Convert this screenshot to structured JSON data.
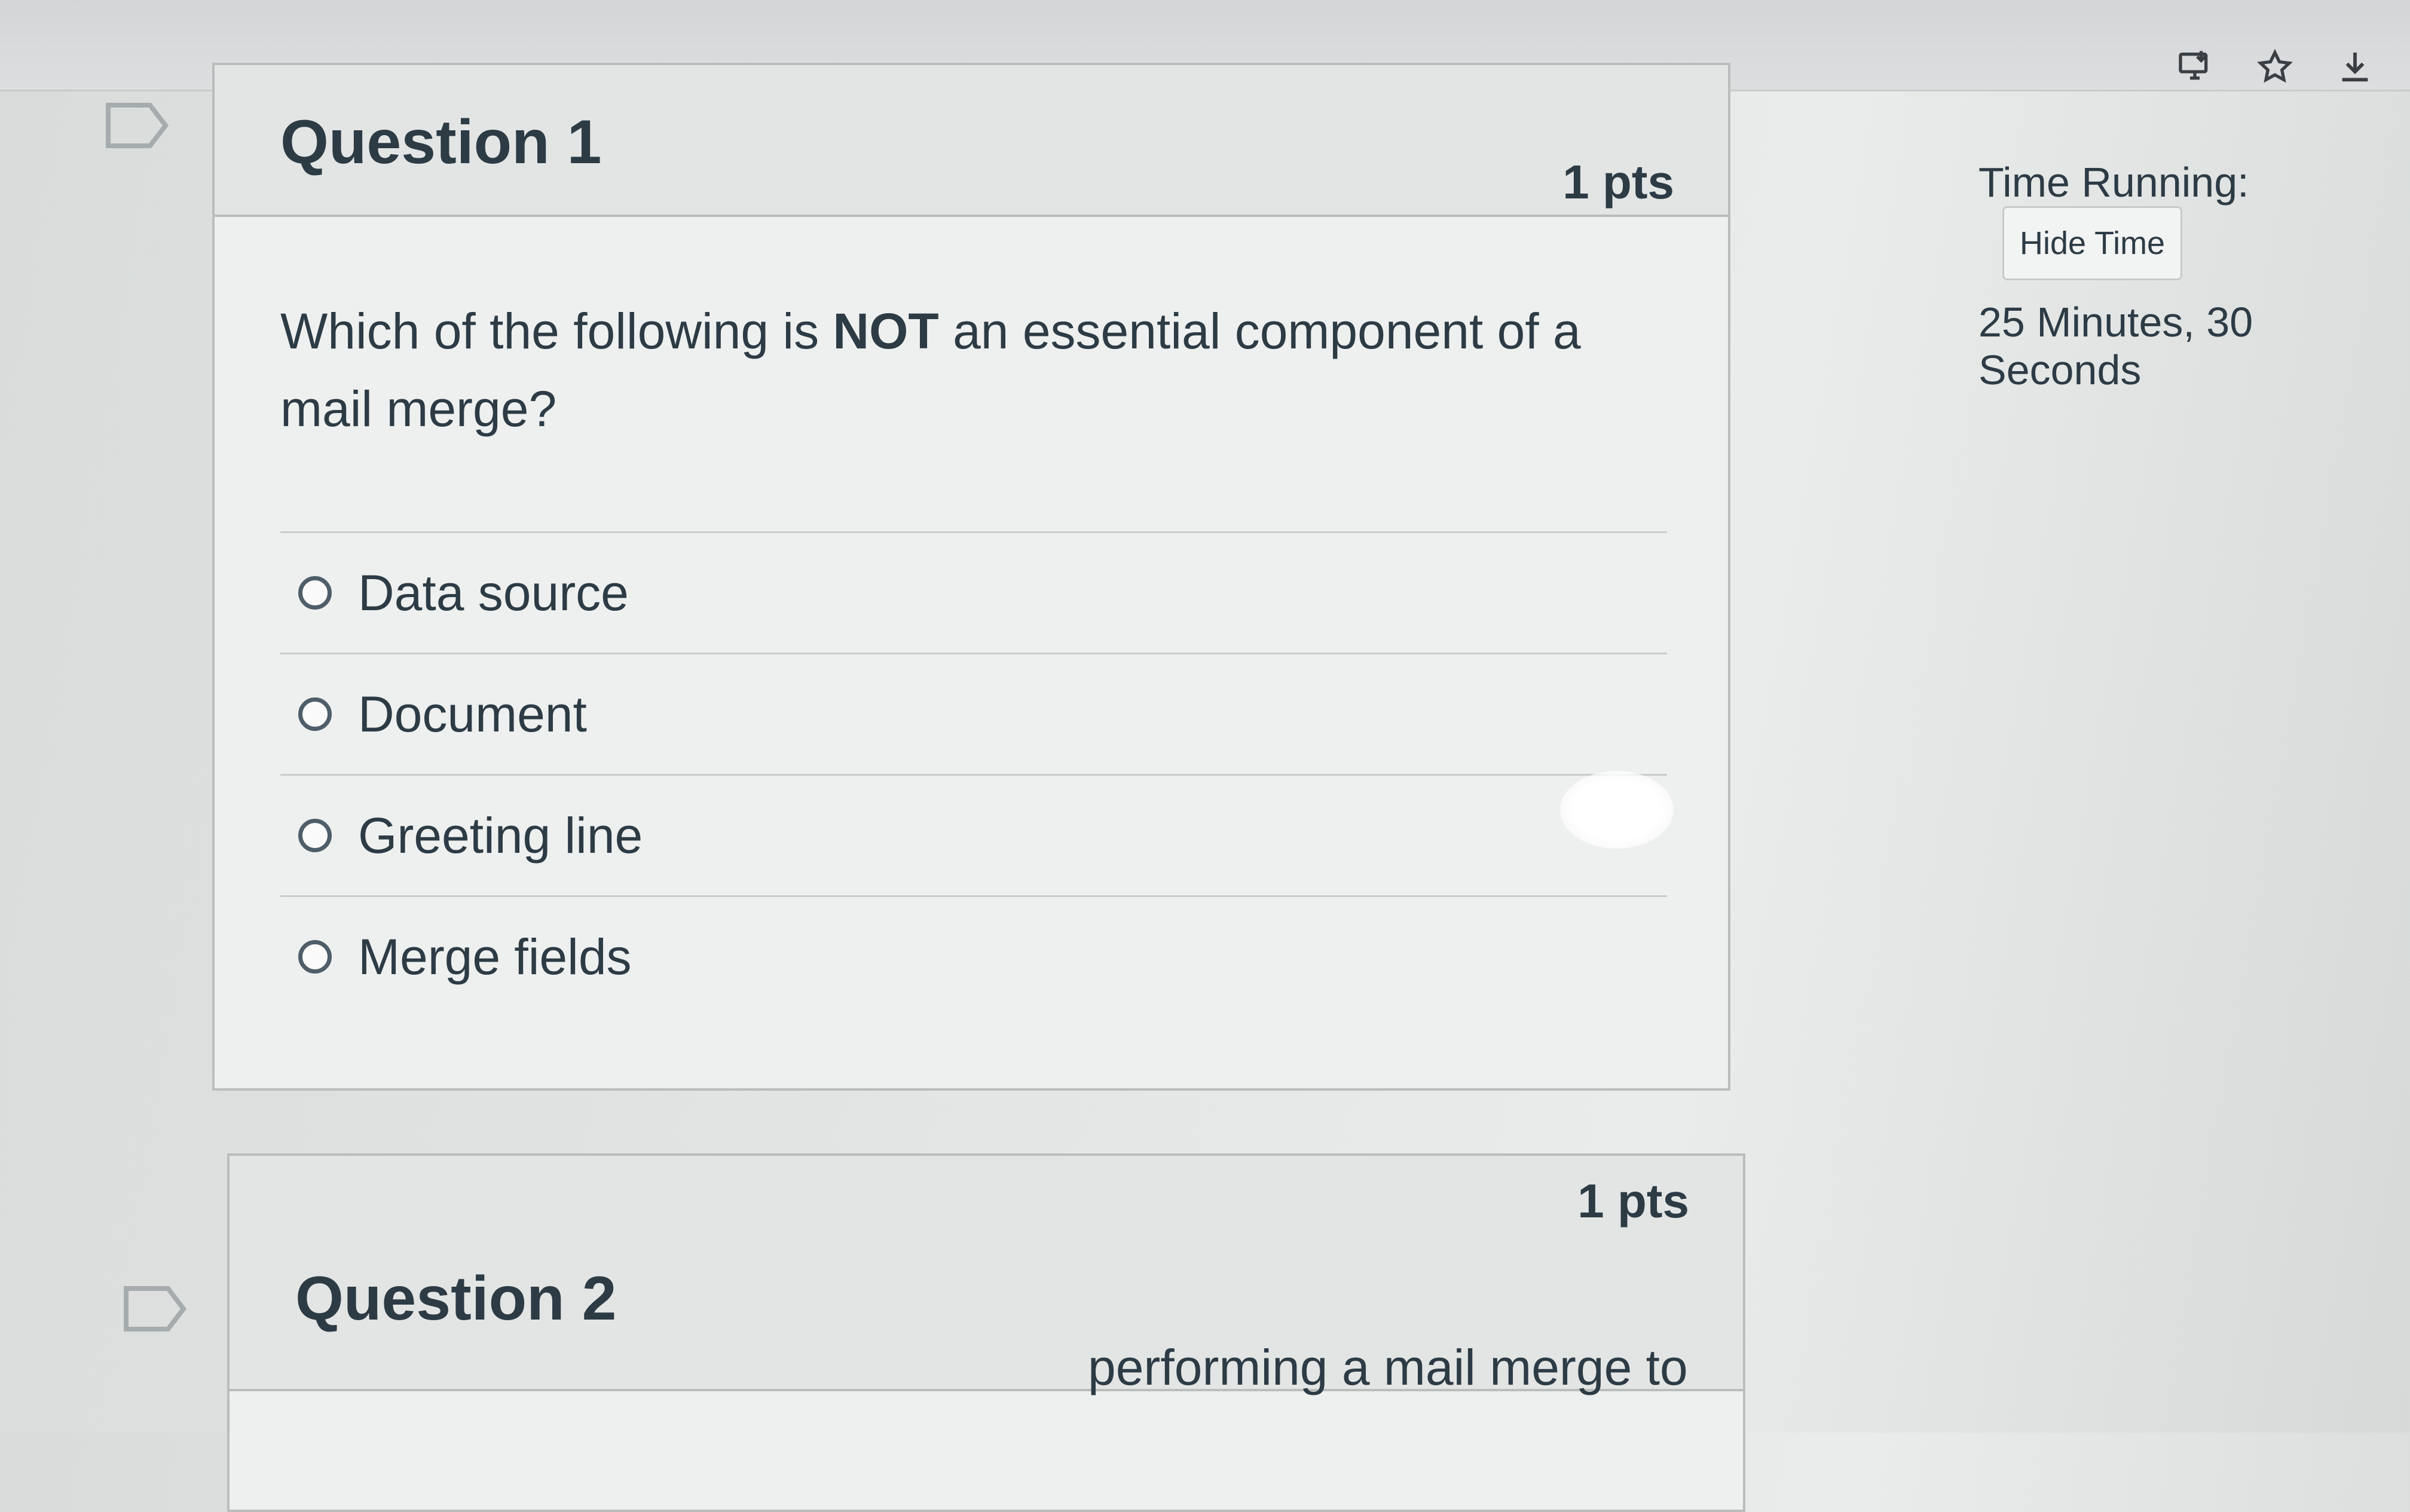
{
  "browser": {
    "icons": [
      "install-app-icon",
      "bookmark-star-icon",
      "download-icon"
    ]
  },
  "timer": {
    "label": "Time Running:",
    "hide_button": "Hide Time",
    "value": "25 Minutes, 30 Seconds"
  },
  "question1": {
    "title": "Question 1",
    "points": "1 pts",
    "text_before": "Which of the following is ",
    "text_bold": "NOT",
    "text_after": " an essential component of a mail merge?",
    "answers": [
      {
        "label": "Data source"
      },
      {
        "label": "Document"
      },
      {
        "label": "Greeting line"
      },
      {
        "label": "Merge fields"
      }
    ]
  },
  "question2": {
    "title": "Question 2",
    "points": "1 pts",
    "partial_text": "performing a mail merge to"
  }
}
